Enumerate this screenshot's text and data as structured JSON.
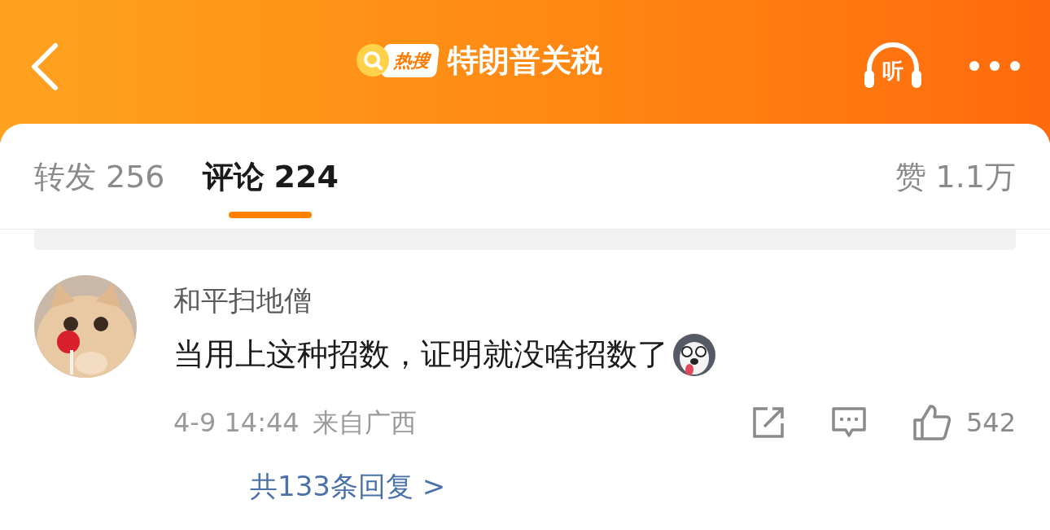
{
  "header": {
    "badge": "热搜",
    "title": "特朗普关税",
    "listen_label": "听"
  },
  "tabs": [
    {
      "label": "转发",
      "count": "256",
      "selected": false
    },
    {
      "label": "评论",
      "count": "224",
      "selected": true
    },
    {
      "label": "赞",
      "count": "1.1万",
      "selected": false
    }
  ],
  "comment": {
    "author": "和平扫地僧",
    "text": "当用上这种招数，证明就没啥招数了",
    "time": "4-9 14:44",
    "location": "来自广西",
    "likes": "542",
    "replies_link": "共133条回复 >"
  }
}
